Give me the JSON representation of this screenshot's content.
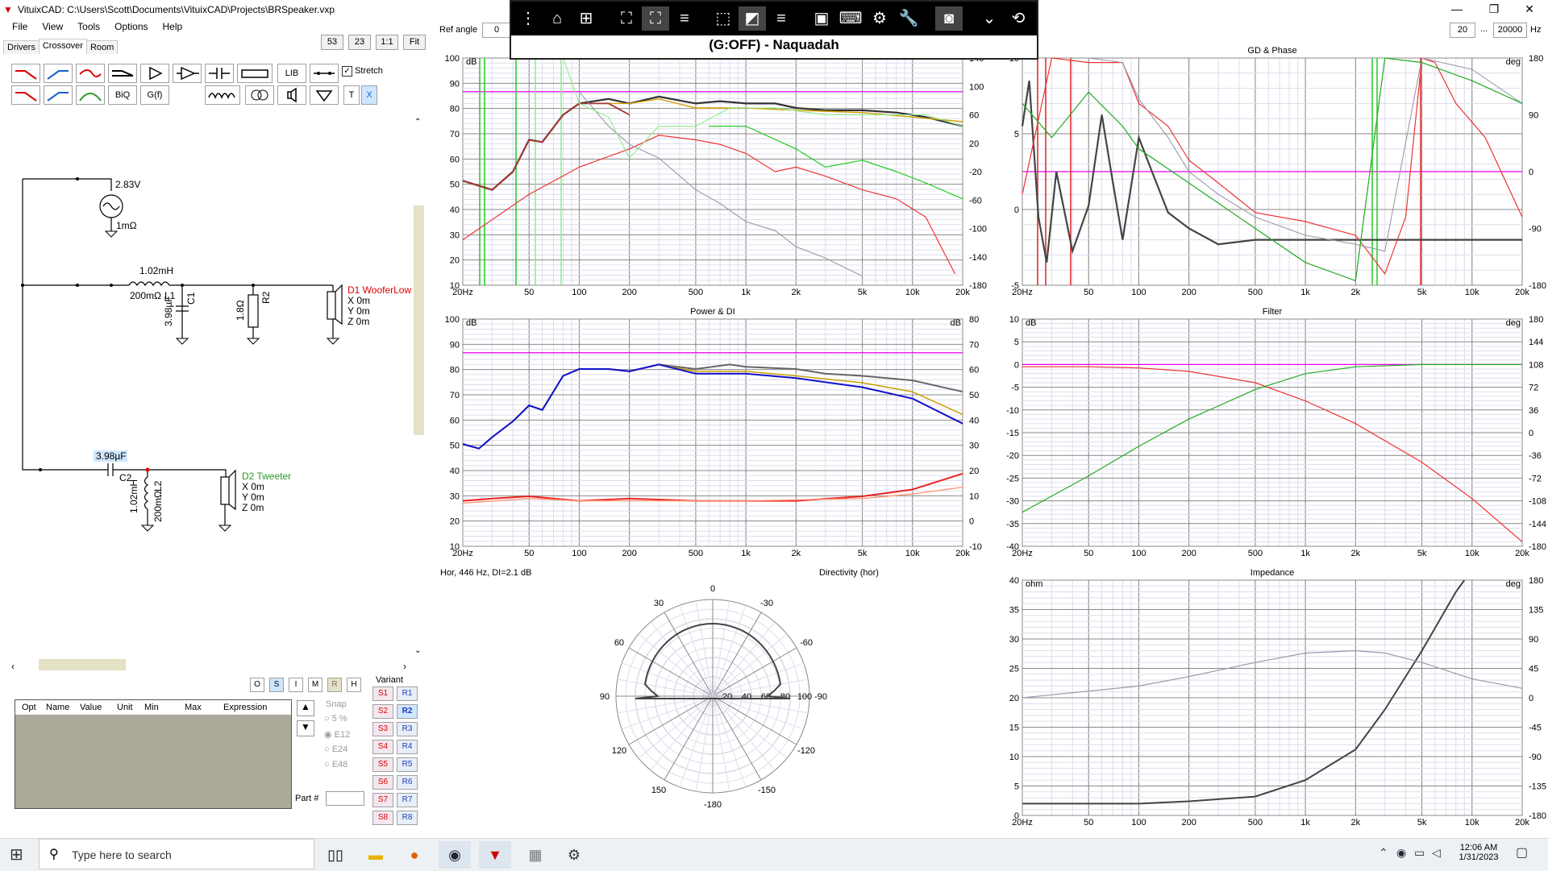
{
  "window": {
    "title": "VituixCAD: C:\\Users\\Scott\\Documents\\VituixCAD\\Projects\\BRSpeaker.vxp",
    "min": "—",
    "max": "❐",
    "close": "✕"
  },
  "menu": [
    "File",
    "View",
    "Tools",
    "Options",
    "Help"
  ],
  "tabs": [
    "Drivers",
    "Crossover",
    "Room"
  ],
  "zoom": {
    "a": "53",
    "b": "23",
    "ratio": "1:1",
    "fit": "Fit"
  },
  "toolbar": {
    "lib": "LIB",
    "stretch": "Stretch",
    "biq": "BiQ",
    "gf": "G(f)",
    "t": "T",
    "x": "X"
  },
  "schematic": {
    "source_v": "2.83V",
    "source_r": "1mΩ",
    "l1_val": "1.02mH",
    "l1_r": "200mΩ",
    "l1_name": "L1",
    "c1_val": "3.98µF",
    "c1_name": "C1",
    "r2_val": "1.8Ω",
    "r2_name": "R2",
    "d1_name": "D1 WooferLow",
    "d1_x": "X 0m",
    "d1_y": "Y 0m",
    "d1_z": "Z 0m",
    "c2_val": "3.98µF",
    "c2_name": "C2",
    "l2_val": "1.02mH",
    "l2_r": "200mΩ",
    "l2_name": "L2",
    "d2_name": "D2 Tweeter",
    "d2_x": "X 0m",
    "d2_y": "Y 0m",
    "d2_z": "Z 0m"
  },
  "optbtns": [
    "O",
    "S",
    "I",
    "M",
    "R",
    "H"
  ],
  "table": {
    "cols": [
      "Opt",
      "Name",
      "Value",
      "Unit",
      "Min",
      "Max",
      "Expression"
    ]
  },
  "snap": {
    "label": "Snap",
    "opts": [
      "5 %",
      "E12",
      "E24",
      "E48"
    ],
    "part": "Part #"
  },
  "variant": {
    "label": "Variant",
    "s": [
      "S1",
      "S2",
      "S3",
      "S4",
      "S5",
      "S6",
      "S7",
      "S8"
    ],
    "r": [
      "R1",
      "R2",
      "R3",
      "R4",
      "R5",
      "R6",
      "R7",
      "R8"
    ]
  },
  "refangle": {
    "label": "Ref angle",
    "value": "0"
  },
  "freqrange": {
    "min": "20",
    "sep": "...",
    "max": "20000",
    "unit": "Hz"
  },
  "overlay": {
    "status": "(G:OFF) - Naquadah"
  },
  "charts": {
    "spl": {
      "ylabel": "dB",
      "yticks": [
        "100",
        "90",
        "80",
        "70",
        "60",
        "50",
        "40",
        "30",
        "20",
        "10"
      ],
      "y2ticks": [
        "140",
        "100",
        "60",
        "20",
        "-20",
        "-60",
        "-100",
        "-140",
        "-180"
      ]
    },
    "gd": {
      "title": "GD & Phase",
      "y2label": "deg",
      "yticks": [
        "10",
        "5",
        "0",
        "-5"
      ],
      "y2ticks": [
        "180",
        "90",
        "0",
        "-90",
        "-180"
      ]
    },
    "power": {
      "title": "Power & DI",
      "ylabel": "dB",
      "y2label": "dB",
      "yticks": [
        "100",
        "90",
        "80",
        "70",
        "60",
        "50",
        "40",
        "30",
        "20",
        "10"
      ],
      "y2ticks": [
        "80",
        "70",
        "60",
        "50",
        "40",
        "30",
        "20",
        "10",
        "0",
        "-10"
      ]
    },
    "filter": {
      "title": "Filter",
      "ylabel": "dB",
      "y2label": "deg",
      "yticks": [
        "10",
        "5",
        "0",
        "-5",
        "-10",
        "-15",
        "-20",
        "-25",
        "-30",
        "-35",
        "-40"
      ],
      "y2ticks": [
        "180",
        "144",
        "108",
        "72",
        "36",
        "0",
        "-36",
        "-72",
        "-108",
        "-144",
        "-180"
      ]
    },
    "impedance": {
      "title": "Impedance",
      "ylabel": "ohm",
      "y2label": "deg",
      "yticks": [
        "40",
        "35",
        "30",
        "25",
        "20",
        "15",
        "10",
        "5",
        "0"
      ],
      "y2ticks": [
        "180",
        "135",
        "90",
        "45",
        "0",
        "-45",
        "-90",
        "-135",
        "-180"
      ]
    },
    "xticks": [
      "20Hz",
      "50",
      "100",
      "200",
      "500",
      "1k",
      "2k",
      "5k",
      "10k",
      "20k"
    ],
    "directivity": {
      "info": "Hor, 446 Hz, DI=2.1 dB",
      "title": "Directivity (hor)",
      "angles": [
        "0",
        "30",
        "-30",
        "60",
        "-60",
        "90",
        "-90",
        "120",
        "-120",
        "150",
        "-150",
        "-180"
      ],
      "rings": [
        "20",
        "40",
        "60",
        "80",
        "100"
      ]
    }
  },
  "taskbar": {
    "search": "Type here to search",
    "time": "12:06 AM",
    "date": "1/31/2023"
  }
}
